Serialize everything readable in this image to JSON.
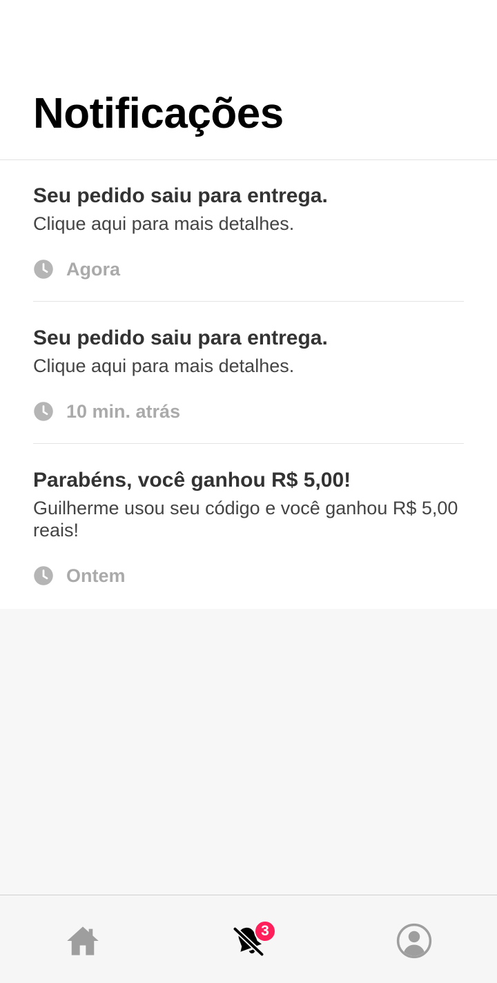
{
  "header": {
    "title": "Notificações"
  },
  "notifications": [
    {
      "title": "Seu pedido saiu para entrega.",
      "body": "Clique aqui para mais detalhes.",
      "time": "Agora"
    },
    {
      "title": "Seu pedido saiu para entrega.",
      "body": "Clique aqui para mais detalhes.",
      "time": "10 min. atrás"
    },
    {
      "title": "Parabéns, você ganhou R$ 5,00!",
      "body": "Guilherme usou seu código e você ganhou R$ 5,00 reais!",
      "time": "Ontem"
    }
  ],
  "nav": {
    "items": [
      {
        "icon": "home-icon",
        "active": false
      },
      {
        "icon": "bell-icon",
        "active": true,
        "badge": "3"
      },
      {
        "icon": "user-icon",
        "active": false
      }
    ]
  },
  "colors": {
    "badge": "#ff1f5a",
    "muted": "#aaaaaa",
    "active_icon": "#000000",
    "inactive_icon": "#9e9e9e"
  }
}
